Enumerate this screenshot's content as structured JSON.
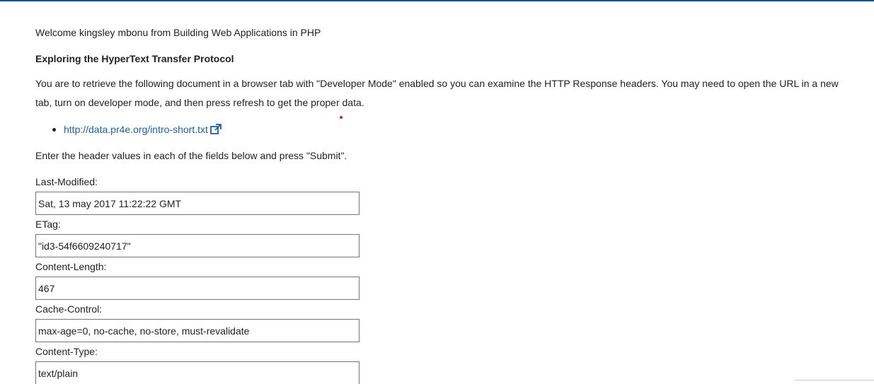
{
  "welcome": "Welcome kingsley mbonu from Building Web Applications in PHP",
  "heading": "Exploring the HyperText Transfer Protocol",
  "instructions": "You are to retrieve the following document in a browser tab with \"Developer Mode\" enabled so you can examine the HTTP Response headers. You may need to open the URL in a new tab, turn on developer mode, and then press refresh to get the proper data.",
  "url": {
    "text": "http://data.pr4e.org/intro-short.txt",
    "icon": "external-link-icon"
  },
  "enter_text": "Enter the header values in each of the fields below and press \"Submit\".",
  "fields": [
    {
      "label": "Last-Modified:",
      "value": "Sat, 13 may 2017 11:22:22 GMT"
    },
    {
      "label": "ETag:",
      "value": "\"id3-54f6609240717\""
    },
    {
      "label": "Content-Length:",
      "value": "467"
    },
    {
      "label": "Cache-Control:",
      "value": "max-age=0, no-cache, no-store, must-revalidate"
    },
    {
      "label": "Content-Type:",
      "value": "text/plain"
    }
  ],
  "colors": {
    "accent": "#0f4c9e",
    "link": "#1f5fad",
    "marker": "#e0201c"
  }
}
